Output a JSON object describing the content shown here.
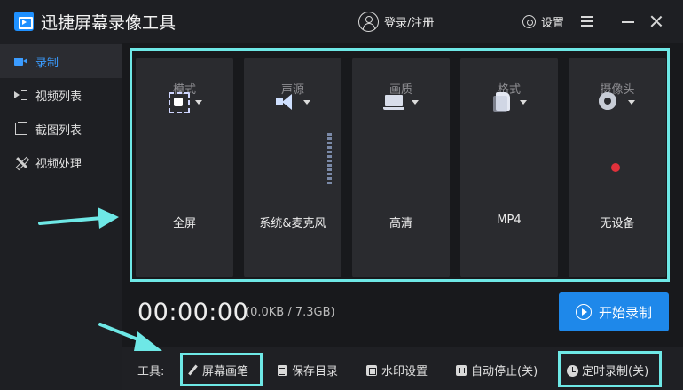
{
  "app": {
    "title": "迅捷屏幕录像工具",
    "login_label": "登录/注册",
    "settings_label": "设置",
    "accent_color": "#1e88ea"
  },
  "sidebar": {
    "items": [
      {
        "label": "录制",
        "icon": "video-icon",
        "active": true
      },
      {
        "label": "视频列表",
        "icon": "list-icon",
        "active": false
      },
      {
        "label": "截图列表",
        "icon": "crop-icon",
        "active": false
      },
      {
        "label": "视频处理",
        "icon": "tool-icon",
        "active": false
      }
    ]
  },
  "options": {
    "mode": {
      "label": "模式",
      "value": "全屏",
      "icon": "fullscreen-icon"
    },
    "audio": {
      "label": "声源",
      "value": "系统&麦克风",
      "icon": "speaker-icon"
    },
    "quality": {
      "label": "画质",
      "value": "高清",
      "icon": "laptop-icon"
    },
    "format": {
      "label": "格式",
      "value": "MP4",
      "icon": "file-icon"
    },
    "camera": {
      "label": "摄像头",
      "value": "无设备",
      "icon": "camera-icon"
    }
  },
  "recorder": {
    "timer": "00:00:00",
    "size": "(0.0KB / 7.3GB)",
    "start_label": "开始录制"
  },
  "toolbar": {
    "label": "工具:",
    "pen": "屏幕画笔",
    "save_dir": "保存目录",
    "watermark": "水印设置",
    "auto_stop": "自动停止(关)",
    "scheduled": "定时录制(关)"
  },
  "annotation_color": "#6ee8e6"
}
